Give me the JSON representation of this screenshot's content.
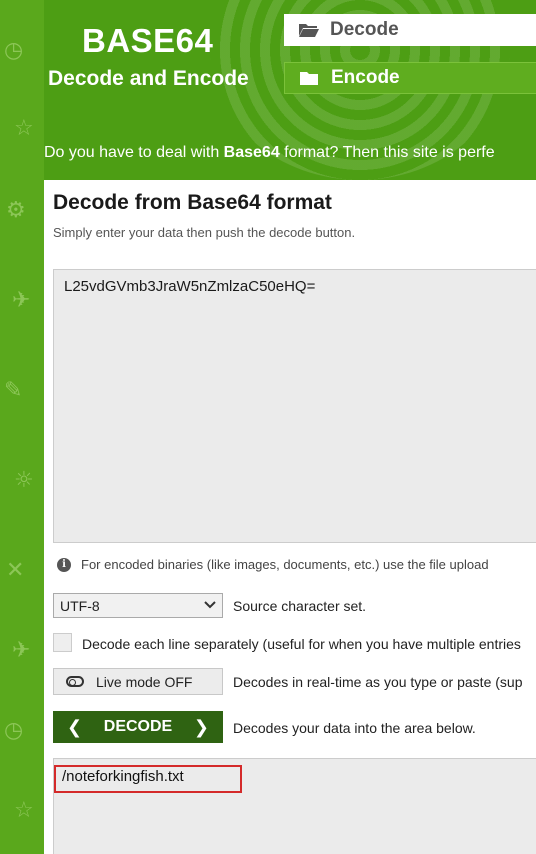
{
  "header": {
    "title": "BASE64",
    "subtitle": "Decode and Encode",
    "nav": [
      {
        "label": "Decode",
        "icon": "folder-open-icon"
      },
      {
        "label": "Encode",
        "icon": "folder-icon"
      }
    ],
    "tagline_prefix": "Do you have to deal with ",
    "tagline_bold": "Base64",
    "tagline_suffix": " format? Then this site is perfe"
  },
  "panel": {
    "title": "Decode from Base64 format",
    "subtitle": "Simply enter your data then push the decode button.",
    "input_value": "L25vdGVmb3JraW5nZmlzaC50eHQ=",
    "info_text": "For encoded binaries (like images, documents, etc.) use the file upload",
    "charset": {
      "selected": "UTF-8",
      "label": "Source character set."
    },
    "each_line": {
      "label": "Decode each line separately (useful for when you have multiple entries",
      "checked": false
    },
    "live_mode": {
      "label": "Live mode OFF",
      "description": "Decodes in real-time as you type or paste (sup"
    },
    "decode": {
      "label": "DECODE",
      "description": "Decodes your data into the area below."
    },
    "output_value": "/noteforkingfish.txt"
  },
  "colors": {
    "brand_green": "#4a9c12",
    "dark_green": "#2f6312",
    "highlight_red": "#d42a2a"
  }
}
